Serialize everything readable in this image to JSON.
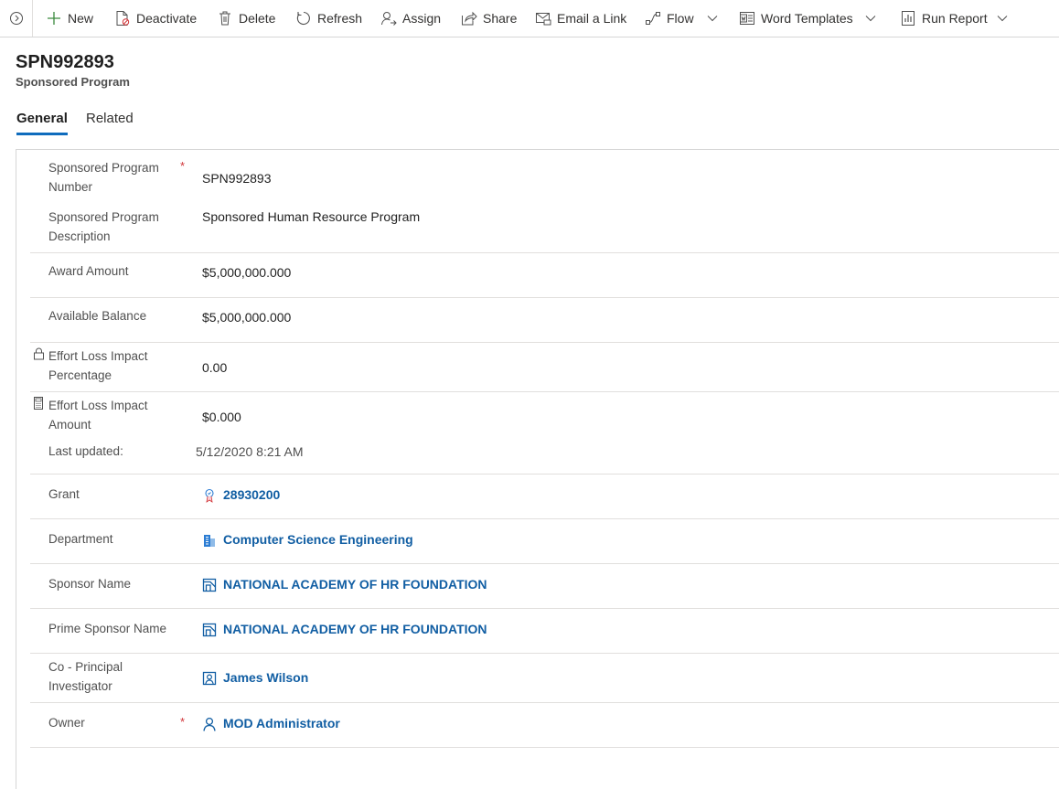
{
  "commandbar": {
    "items": [
      {
        "label": "New",
        "icon": "plus-icon"
      },
      {
        "label": "Deactivate",
        "icon": "deactivate-icon"
      },
      {
        "label": "Delete",
        "icon": "trash-icon"
      },
      {
        "label": "Refresh",
        "icon": "refresh-icon"
      },
      {
        "label": "Assign",
        "icon": "assign-icon"
      },
      {
        "label": "Share",
        "icon": "share-icon"
      },
      {
        "label": "Email a Link",
        "icon": "email-link-icon"
      },
      {
        "label": "Flow",
        "icon": "flow-icon"
      },
      {
        "label": "Word Templates",
        "icon": "word-icon"
      },
      {
        "label": "Run Report",
        "icon": "report-icon"
      }
    ]
  },
  "header": {
    "title": "SPN992893",
    "entity": "Sponsored Program"
  },
  "tabs": [
    {
      "label": "General",
      "active": true
    },
    {
      "label": "Related",
      "active": false
    }
  ],
  "fields": {
    "program_number": {
      "label": "Sponsored Program Number",
      "value": "SPN992893",
      "required": "*"
    },
    "program_description": {
      "label": "Sponsored Program Description",
      "value": "Sponsored Human Resource Program"
    },
    "award_amount": {
      "label": "Award Amount",
      "value": "$5,000,000.000"
    },
    "available_balance": {
      "label": "Available Balance",
      "value": "$5,000,000.000"
    },
    "effort_loss_pct": {
      "label": "Effort Loss Impact Percentage",
      "value": "0.00"
    },
    "effort_loss_amt": {
      "label": "Effort Loss Impact Amount",
      "value": "$0.000"
    },
    "last_updated": {
      "label": "Last updated:",
      "value": "5/12/2020 8:21 AM"
    },
    "grant": {
      "label": "Grant",
      "value": "28930200",
      "icon": "grant-icon"
    },
    "department": {
      "label": "Department",
      "value": "Computer Science Engineering",
      "icon": "building-icon"
    },
    "sponsor_name": {
      "label": "Sponsor Name",
      "value": "NATIONAL ACADEMY OF HR FOUNDATION",
      "icon": "account-icon"
    },
    "prime_sponsor_name": {
      "label": "Prime Sponsor Name",
      "value": "NATIONAL ACADEMY OF HR FOUNDATION",
      "icon": "account-icon"
    },
    "co_pi": {
      "label": "Co - Principal Investigator",
      "value": "James Wilson",
      "icon": "contact-icon"
    },
    "owner": {
      "label": "Owner",
      "value": "MOD Administrator",
      "icon": "user-icon",
      "required": "*"
    }
  },
  "colors": {
    "accent": "#0f6cbd",
    "link": "#115ea3",
    "required": "#d13438"
  }
}
